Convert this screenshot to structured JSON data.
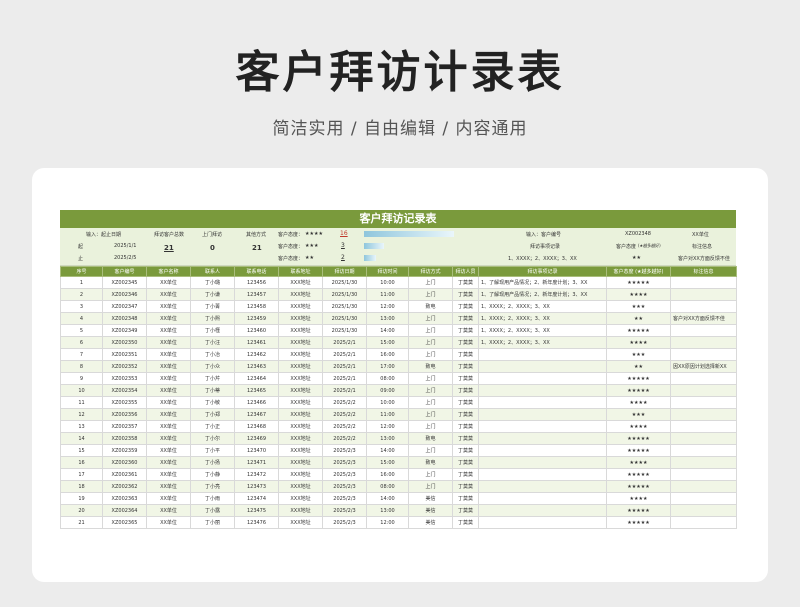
{
  "hero": {
    "title": "客户拜访计录表",
    "subtitle": "简洁实用 / 自由编辑 / 内容通用"
  },
  "sheet": {
    "title": "客户拜访记录表",
    "summary": {
      "input_label": "输入：起止日期",
      "from_label": "起",
      "from_date": "2025/1/1",
      "to_label": "止",
      "to_date": "2025/2/5",
      "total_label": "拜访客户总数",
      "total_value": "21",
      "door_label": "上门拜访",
      "door_value": "0",
      "other_label": "其他方式",
      "other_value": "21",
      "att1_label": "客户态度：",
      "att1_stars": "★★★★",
      "att1_value": "16",
      "att2_label": "客户态度：",
      "att2_stars": "★★★",
      "att2_value": "3",
      "att3_label": "客户态度：",
      "att3_stars": "★★",
      "att3_value": "2",
      "cust_input_label": "输入：客户编号",
      "cust_id": "XZ002348",
      "cust_unit": "XX单位",
      "record_label": "拜访事项记录",
      "record_value": "1、XXXX；2、XXXX；3、XX",
      "attitude_label": "客户态度",
      "attitude_hint": "(★越多越好)",
      "attitude_value": "★★",
      "note_label": "标注信息",
      "note_value": "客户对XX方面反馈不佳"
    },
    "columns": [
      "序号",
      "客户编号",
      "客户名称",
      "联系人",
      "联系电话",
      "联系地址",
      "拜访日期",
      "拜访时间",
      "拜访方式",
      "拜访人员",
      "拜访事项记录",
      "客户态度 (★越多越好)",
      "标注信息"
    ],
    "rows": [
      [
        "1",
        "XZ002345",
        "XX单位",
        "丁小璐",
        "123456",
        "XXX地址",
        "2025/1/30",
        "10:00",
        "上门",
        "丁莫莫",
        "1、了解现用产品情况；2、新年度计划；3、XX",
        "★★★★★",
        ""
      ],
      [
        "2",
        "XZ002346",
        "XX单位",
        "丁小谦",
        "123457",
        "XXX地址",
        "2025/1/30",
        "11:00",
        "上门",
        "丁莫莫",
        "1、了解现用产品情况；2、新年度计划；3、XX",
        "★★★★",
        ""
      ],
      [
        "3",
        "XZ002347",
        "XX单位",
        "丁小菁",
        "123458",
        "XXX地址",
        "2025/1/30",
        "12:00",
        "致电",
        "丁莫莫",
        "1、XXXX；2、XXXX；3、XX",
        "★★★",
        ""
      ],
      [
        "4",
        "XZ002348",
        "XX单位",
        "丁小熙",
        "123459",
        "XXX地址",
        "2025/1/30",
        "13:00",
        "上门",
        "丁莫莫",
        "1、XXXX；2、XXXX；3、XX",
        "★★",
        "客户对XX方面反馈不佳"
      ],
      [
        "5",
        "XZ002349",
        "XX单位",
        "丁小槿",
        "123460",
        "XXX地址",
        "2025/1/30",
        "14:00",
        "上门",
        "丁莫莫",
        "1、XXXX；2、XXXX；3、XX",
        "★★★★★",
        ""
      ],
      [
        "6",
        "XZ002350",
        "XX单位",
        "丁小汪",
        "123461",
        "XXX地址",
        "2025/2/1",
        "15:00",
        "上门",
        "丁莫莫",
        "1、XXXX；2、XXXX；3、XX",
        "★★★★",
        ""
      ],
      [
        "7",
        "XZ002351",
        "XX单位",
        "丁小冶",
        "123462",
        "XXX地址",
        "2025/2/1",
        "16:00",
        "上门",
        "丁莫莫",
        "",
        "★★★",
        ""
      ],
      [
        "8",
        "XZ002352",
        "XX单位",
        "丁小众",
        "123463",
        "XXX地址",
        "2025/2/1",
        "17:00",
        "致电",
        "丁莫莫",
        "",
        "★★",
        "因XX原因计划选择新XX"
      ],
      [
        "9",
        "XZ002353",
        "XX单位",
        "丁小芹",
        "123464",
        "XXX地址",
        "2025/2/1",
        "08:00",
        "上门",
        "丁莫莫",
        "",
        "★★★★★",
        ""
      ],
      [
        "10",
        "XZ002354",
        "XX单位",
        "丁小蒂",
        "123465",
        "XXX地址",
        "2025/2/1",
        "09:00",
        "上门",
        "丁莫莫",
        "",
        "★★★★★",
        ""
      ],
      [
        "11",
        "XZ002355",
        "XX单位",
        "丁小敏",
        "123466",
        "XXX地址",
        "2025/2/2",
        "10:00",
        "上门",
        "丁莫莫",
        "",
        "★★★★",
        ""
      ],
      [
        "12",
        "XZ002356",
        "XX单位",
        "丁小郑",
        "123467",
        "XXX地址",
        "2025/2/2",
        "11:00",
        "上门",
        "丁莫莫",
        "",
        "★★★",
        ""
      ],
      [
        "13",
        "XZ002357",
        "XX单位",
        "丁小正",
        "123468",
        "XXX地址",
        "2025/2/2",
        "12:00",
        "上门",
        "丁莫莫",
        "",
        "★★★★",
        ""
      ],
      [
        "14",
        "XZ002358",
        "XX单位",
        "丁小尔",
        "123469",
        "XXX地址",
        "2025/2/2",
        "13:00",
        "致电",
        "丁莫莫",
        "",
        "★★★★★",
        ""
      ],
      [
        "15",
        "XZ002359",
        "XX单位",
        "丁小平",
        "123470",
        "XXX地址",
        "2025/2/3",
        "14:00",
        "上门",
        "丁莫莫",
        "",
        "★★★★★",
        ""
      ],
      [
        "16",
        "XZ002360",
        "XX单位",
        "丁小扬",
        "123471",
        "XXX地址",
        "2025/2/3",
        "15:00",
        "致电",
        "丁莫莫",
        "",
        "★★★★",
        ""
      ],
      [
        "17",
        "XZ002361",
        "XX单位",
        "丁小静",
        "123472",
        "XXX地址",
        "2025/2/3",
        "16:00",
        "上门",
        "丁莫莫",
        "",
        "★★★★★",
        ""
      ],
      [
        "18",
        "XZ002362",
        "XX单位",
        "丁小亮",
        "123473",
        "XXX地址",
        "2025/2/3",
        "08:00",
        "上门",
        "丁莫莫",
        "",
        "★★★★★",
        ""
      ],
      [
        "19",
        "XZ002363",
        "XX单位",
        "丁小雨",
        "123474",
        "XXX地址",
        "2025/2/3",
        "14:00",
        "美信",
        "丁莫莫",
        "",
        "★★★★",
        ""
      ],
      [
        "20",
        "XZ002364",
        "XX单位",
        "丁小露",
        "123475",
        "XXX地址",
        "2025/2/3",
        "13:00",
        "美信",
        "丁莫莫",
        "",
        "★★★★★",
        ""
      ],
      [
        "21",
        "XZ002365",
        "XX单位",
        "丁小丽",
        "123476",
        "XXX地址",
        "2025/2/3",
        "12:00",
        "美信",
        "丁莫莫",
        "",
        "★★★★★",
        ""
      ]
    ]
  },
  "colors": {
    "header_green": "#7a9a3c",
    "summary_bg": "#eaf2dc",
    "alt_row": "#f1f6e6"
  }
}
